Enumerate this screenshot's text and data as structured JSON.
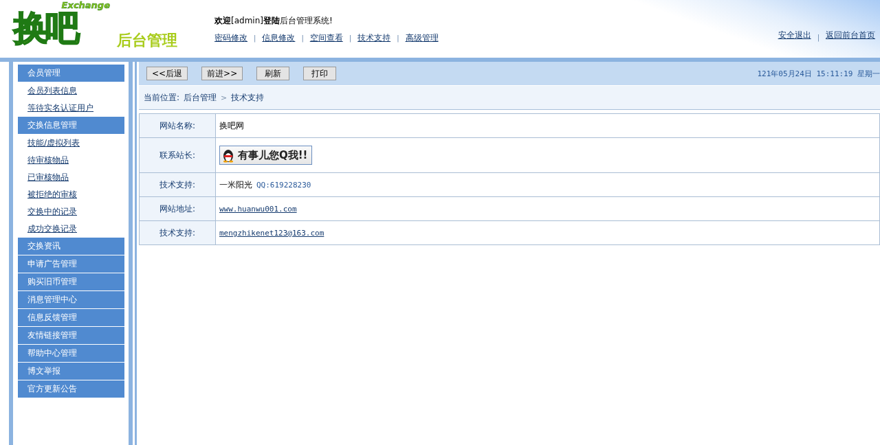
{
  "logo": {
    "main": "换吧",
    "sub": "Exchange",
    "caption": "后台管理"
  },
  "link_separator": "|",
  "welcome": "**欢迎**[admin]**登陆**后台管理系统!",
  "top_links": [
    "密码修改",
    "信息修改",
    "空间查看",
    "技术支持",
    "高级管理"
  ],
  "right_links": [
    "安全退出",
    "返回前台首页"
  ],
  "sidebar": [
    {
      "kind": "header",
      "label": "会员管理"
    },
    {
      "kind": "link",
      "label": "会员列表信息"
    },
    {
      "kind": "link",
      "label": "等待实名认证用户"
    },
    {
      "kind": "header",
      "label": "交换信息管理"
    },
    {
      "kind": "link",
      "label": "技能/虚拟列表"
    },
    {
      "kind": "link",
      "label": "待审核物品"
    },
    {
      "kind": "link",
      "label": "已审核物品"
    },
    {
      "kind": "link",
      "label": "被拒绝的审核"
    },
    {
      "kind": "link",
      "label": "交换中的记录"
    },
    {
      "kind": "link",
      "label": "成功交换记录"
    },
    {
      "kind": "header",
      "label": "交换资讯"
    },
    {
      "kind": "header",
      "label": "申请广告管理"
    },
    {
      "kind": "header",
      "label": "购买旧币管理"
    },
    {
      "kind": "header",
      "label": "消息管理中心"
    },
    {
      "kind": "header",
      "label": "信息反馈管理"
    },
    {
      "kind": "header",
      "label": "友情链接管理"
    },
    {
      "kind": "header",
      "label": "帮助中心管理"
    },
    {
      "kind": "header",
      "label": "博文举报"
    },
    {
      "kind": "header",
      "label": "官方更新公告"
    }
  ],
  "toolbar": {
    "buttons": [
      "<<后退",
      "前进>>",
      "刷新",
      "打印"
    ],
    "datetime": "121年05月24日 15:11:19 星期一"
  },
  "breadcrumb": {
    "prefix": "当前位置:",
    "items": [
      "后台管理",
      "技术支持"
    ],
    "separator": ">"
  },
  "info_rows": [
    {
      "label": "网站名称:",
      "kind": "text",
      "value": "换吧网"
    },
    {
      "label": "联系站长:",
      "kind": "qq_button",
      "value": "有事儿您Q我!!"
    },
    {
      "label": "技术支持:",
      "kind": "contact",
      "value": "一米阳光",
      "extra": "QQ:619228230"
    },
    {
      "label": "网站地址:",
      "kind": "link",
      "value": "www.huanwu001.com"
    },
    {
      "label": "技术支持:",
      "kind": "link",
      "value": "mengzhikenet123@163.com"
    }
  ]
}
